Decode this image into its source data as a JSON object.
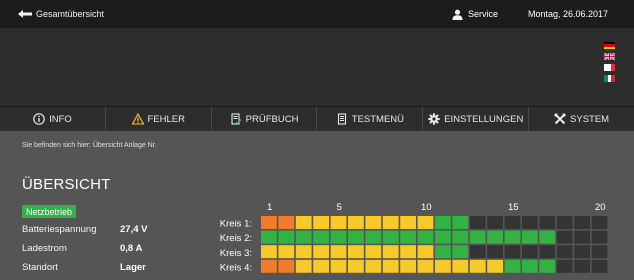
{
  "topbar": {
    "back_label": "Gesamtübersicht",
    "service_label": "Service",
    "date": "Montag, 26.06.2017"
  },
  "languages": [
    "german-flag-icon",
    "english-flag-icon",
    "french-flag-icon",
    "italian-flag-icon"
  ],
  "nav": [
    {
      "label": "INFO",
      "icon": "info-icon"
    },
    {
      "label": "FEHLER",
      "icon": "warning-icon"
    },
    {
      "label": "PRÜFBUCH",
      "icon": "logbook-icon"
    },
    {
      "label": "TESTMENÜ",
      "icon": "test-menu-icon"
    },
    {
      "label": "EINSTELLUNGEN",
      "icon": "gear-icon"
    },
    {
      "label": "SYSTEM",
      "icon": "tools-icon"
    }
  ],
  "breadcrumb": "Sie befinden sich hier: Übersicht Anlage Nr.",
  "page_title": "ÜBERSICHT",
  "status_badge": "Netzbetrieb",
  "stats": [
    {
      "label": "Batteriespannung",
      "value": "27,4 V"
    },
    {
      "label": "Ladestrom",
      "value": "0,8 A"
    },
    {
      "label": "Standort",
      "value": "Lager"
    }
  ],
  "colors": {
    "orange": "#f07c2c",
    "yellow": "#f7ca2a",
    "green": "#33b344",
    "empty": "#343434",
    "badge": "#38b04a"
  },
  "chart_data": {
    "type": "heatmap",
    "x_ticks": [
      "1",
      "5",
      "10",
      "15",
      "20"
    ],
    "x_tick_values": [
      1,
      5,
      10,
      15,
      20
    ],
    "slot_count": 20,
    "rows": [
      {
        "label": "Kreis 1:",
        "cells": [
          "o",
          "o",
          "y",
          "y",
          "y",
          "y",
          "y",
          "y",
          "y",
          "y",
          "g",
          "g",
          "-",
          "-",
          "-",
          "-",
          "-",
          "-",
          "-",
          "-"
        ]
      },
      {
        "label": "Kreis 2:",
        "cells": [
          "g",
          "g",
          "g",
          "g",
          "g",
          "g",
          "g",
          "g",
          "g",
          "g",
          "g",
          "g",
          "g",
          "g",
          "g",
          "g",
          "g",
          "-",
          "-",
          "-"
        ]
      },
      {
        "label": "Kreis 3:",
        "cells": [
          "y",
          "y",
          "y",
          "y",
          "y",
          "y",
          "y",
          "y",
          "y",
          "y",
          "g",
          "g",
          "-",
          "-",
          "-",
          "-",
          "-",
          "-",
          "-",
          "-"
        ]
      },
      {
        "label": "Kreis 4:",
        "cells": [
          "o",
          "o",
          "y",
          "y",
          "y",
          "y",
          "y",
          "y",
          "y",
          "y",
          "y",
          "y",
          "y",
          "y",
          "g",
          "g",
          "g",
          "-",
          "-",
          "-"
        ]
      }
    ],
    "legend": {
      "o": "orange",
      "y": "yellow",
      "g": "green",
      "-": "empty"
    }
  }
}
